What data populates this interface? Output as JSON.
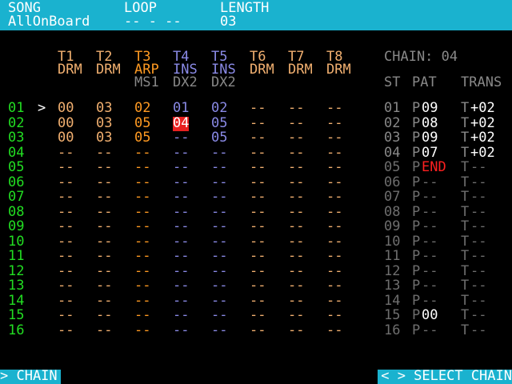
{
  "colors": {
    "bar": "#1ab2cf",
    "row_num": "#22dd22",
    "drm": "#f2b070",
    "arp": "#ff9a22",
    "ins": "#8a8ae6",
    "dim": "#888888",
    "white": "#ffffff",
    "red": "#ff2020",
    "chain_dim": "#6e6e6e"
  },
  "header": {
    "song_label": "SONG",
    "song_value": "AllOnBoard",
    "loop_label": "LOOP",
    "loop_value": "-- - --",
    "length_label": "LENGTH",
    "length_value": "03"
  },
  "tracks": [
    {
      "name": "T1",
      "type": "DRM",
      "sub": "",
      "color": "drm"
    },
    {
      "name": "T2",
      "type": "DRM",
      "sub": "",
      "color": "drm"
    },
    {
      "name": "T3",
      "type": "ARP",
      "sub": "MS1",
      "color": "arp"
    },
    {
      "name": "T4",
      "type": "INS",
      "sub": "DX2",
      "color": "ins"
    },
    {
      "name": "T5",
      "type": "INS",
      "sub": "DX2",
      "color": "ins"
    },
    {
      "name": "T6",
      "type": "DRM",
      "sub": "",
      "color": "drm"
    },
    {
      "name": "T7",
      "type": "DRM",
      "sub": "",
      "color": "drm"
    },
    {
      "name": "T8",
      "type": "DRM",
      "sub": "",
      "color": "drm"
    }
  ],
  "cursor": ">",
  "rows": [
    {
      "num": "01",
      "cells": [
        "00",
        "03",
        "02",
        "01",
        "02",
        "--",
        "--",
        "--"
      ]
    },
    {
      "num": "02",
      "cells": [
        "00",
        "03",
        "05",
        "04",
        "05",
        "--",
        "--",
        "--"
      ]
    },
    {
      "num": "03",
      "cells": [
        "00",
        "03",
        "05",
        "--",
        "05",
        "--",
        "--",
        "--"
      ]
    },
    {
      "num": "04",
      "cells": [
        "--",
        "--",
        "--",
        "--",
        "--",
        "--",
        "--",
        "--"
      ]
    },
    {
      "num": "05",
      "cells": [
        "--",
        "--",
        "--",
        "--",
        "--",
        "--",
        "--",
        "--"
      ]
    },
    {
      "num": "06",
      "cells": [
        "--",
        "--",
        "--",
        "--",
        "--",
        "--",
        "--",
        "--"
      ]
    },
    {
      "num": "07",
      "cells": [
        "--",
        "--",
        "--",
        "--",
        "--",
        "--",
        "--",
        "--"
      ]
    },
    {
      "num": "08",
      "cells": [
        "--",
        "--",
        "--",
        "--",
        "--",
        "--",
        "--",
        "--"
      ]
    },
    {
      "num": "09",
      "cells": [
        "--",
        "--",
        "--",
        "--",
        "--",
        "--",
        "--",
        "--"
      ]
    },
    {
      "num": "10",
      "cells": [
        "--",
        "--",
        "--",
        "--",
        "--",
        "--",
        "--",
        "--"
      ]
    },
    {
      "num": "11",
      "cells": [
        "--",
        "--",
        "--",
        "--",
        "--",
        "--",
        "--",
        "--"
      ]
    },
    {
      "num": "12",
      "cells": [
        "--",
        "--",
        "--",
        "--",
        "--",
        "--",
        "--",
        "--"
      ]
    },
    {
      "num": "13",
      "cells": [
        "--",
        "--",
        "--",
        "--",
        "--",
        "--",
        "--",
        "--"
      ]
    },
    {
      "num": "14",
      "cells": [
        "--",
        "--",
        "--",
        "--",
        "--",
        "--",
        "--",
        "--"
      ]
    },
    {
      "num": "15",
      "cells": [
        "--",
        "--",
        "--",
        "--",
        "--",
        "--",
        "--",
        "--"
      ]
    },
    {
      "num": "16",
      "cells": [
        "--",
        "--",
        "--",
        "--",
        "--",
        "--",
        "--",
        "--"
      ]
    }
  ],
  "selected": {
    "row": 1,
    "col": 3
  },
  "chain": {
    "title": "CHAIN: 04",
    "col_st": "ST",
    "col_pat": "PAT",
    "col_trans": "TRANS",
    "rows": [
      {
        "st": "01",
        "p": "P",
        "pat": "09",
        "t": "T",
        "trans": "+02",
        "active": true
      },
      {
        "st": "02",
        "p": "P",
        "pat": "08",
        "t": "T",
        "trans": "+02",
        "active": true
      },
      {
        "st": "03",
        "p": "P",
        "pat": "09",
        "t": "T",
        "trans": "+02",
        "active": true
      },
      {
        "st": "04",
        "p": "P",
        "pat": "07",
        "t": "T",
        "trans": "+02",
        "active": true
      },
      {
        "st": "05",
        "p": "P",
        "pat": "END",
        "t": "T",
        "trans": "--",
        "active": false,
        "end": true
      },
      {
        "st": "06",
        "p": "P",
        "pat": "--",
        "t": "T",
        "trans": "--",
        "active": false
      },
      {
        "st": "07",
        "p": "P",
        "pat": "--",
        "t": "T",
        "trans": "--",
        "active": false
      },
      {
        "st": "08",
        "p": "P",
        "pat": "--",
        "t": "T",
        "trans": "--",
        "active": false
      },
      {
        "st": "09",
        "p": "P",
        "pat": "--",
        "t": "T",
        "trans": "--",
        "active": false
      },
      {
        "st": "10",
        "p": "P",
        "pat": "--",
        "t": "T",
        "trans": "--",
        "active": false
      },
      {
        "st": "11",
        "p": "P",
        "pat": "--",
        "t": "T",
        "trans": "--",
        "active": false
      },
      {
        "st": "12",
        "p": "P",
        "pat": "--",
        "t": "T",
        "trans": "--",
        "active": false
      },
      {
        "st": "13",
        "p": "P",
        "pat": "--",
        "t": "T",
        "trans": "--",
        "active": false
      },
      {
        "st": "14",
        "p": "P",
        "pat": "--",
        "t": "T",
        "trans": "--",
        "active": false
      },
      {
        "st": "15",
        "p": "P",
        "pat": "00",
        "t": "T",
        "trans": "--",
        "active": false,
        "bright_pat": true
      },
      {
        "st": "16",
        "p": "P",
        "pat": "--",
        "t": "T",
        "trans": "--",
        "active": false
      }
    ]
  },
  "footer": {
    "left": "> CHAIN",
    "right": "< > SELECT CHAIN"
  }
}
